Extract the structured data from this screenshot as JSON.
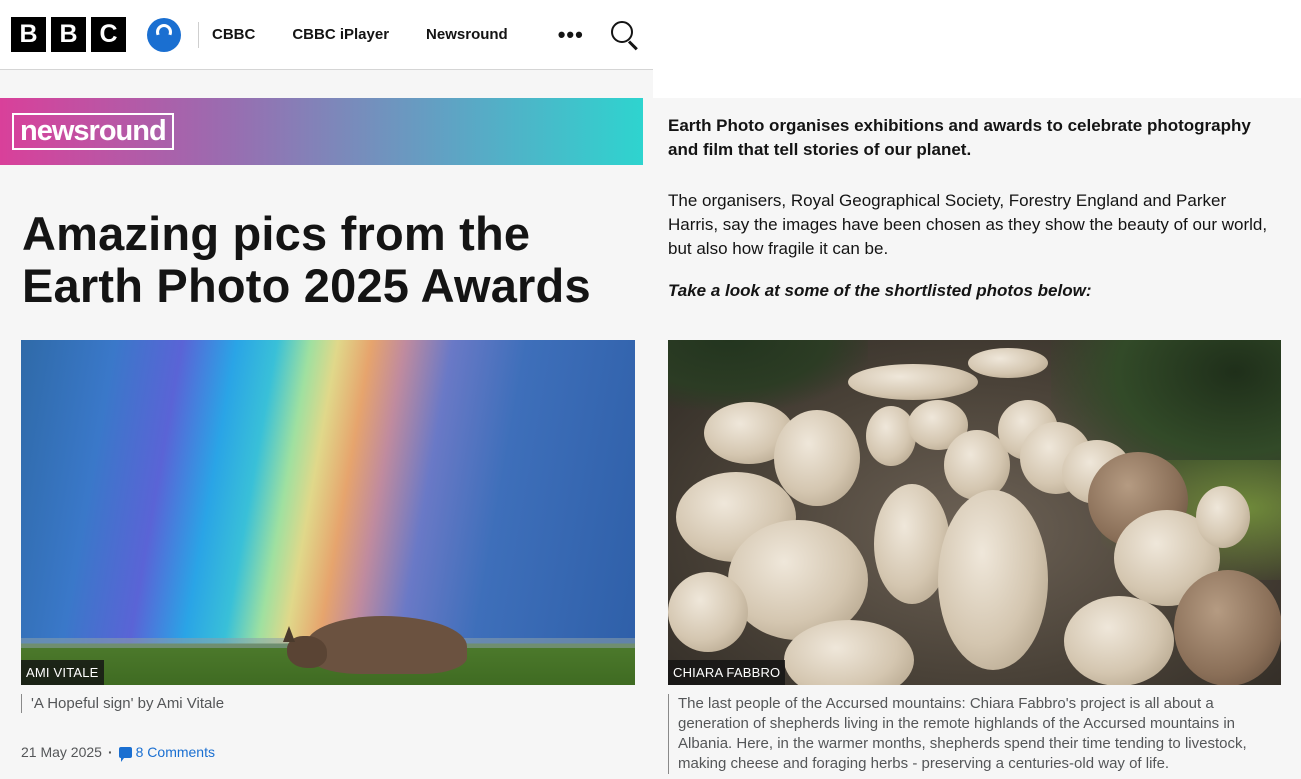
{
  "header": {
    "logo_letters": [
      "B",
      "B",
      "C"
    ],
    "nav": [
      {
        "label": "CBBC"
      },
      {
        "label": "CBBC iPlayer"
      },
      {
        "label": "Newsround"
      }
    ],
    "more_label": "•••"
  },
  "banner": {
    "brand": "newsround"
  },
  "article": {
    "title": "Amazing pics from the Earth Photo 2025 Awards",
    "image1": {
      "credit": "AMI VITALE",
      "caption": "'A Hopeful sign' by Ami Vitale"
    },
    "date": "21 May 2025",
    "comments": "8 Comments",
    "intro": "Earth Photo organises exhibitions and awards to celebrate photography and film that tell stories of our planet.",
    "paragraph": "The organisers, Royal Geographical Society, Forestry England and Parker Harris, say the images have been chosen as they show the beauty of our world, but also how fragile it can be.",
    "lead_in": "Take a look at some of the shortlisted photos below:",
    "image2": {
      "credit": "CHIARA FABBRO",
      "caption": "The last people of the Accursed mountains: Chiara Fabbro's project is all about a generation of shepherds living in the remote highlands of the Accursed mountains in Albania. Here, in the warmer months, shepherds spend their time tending to livestock, making cheese and foraging herbs - preserving a centuries-old way of life."
    }
  },
  "colors": {
    "accent": "#1a6fd1",
    "banner_start": "#d9409a",
    "banner_end": "#2ed4cf"
  }
}
